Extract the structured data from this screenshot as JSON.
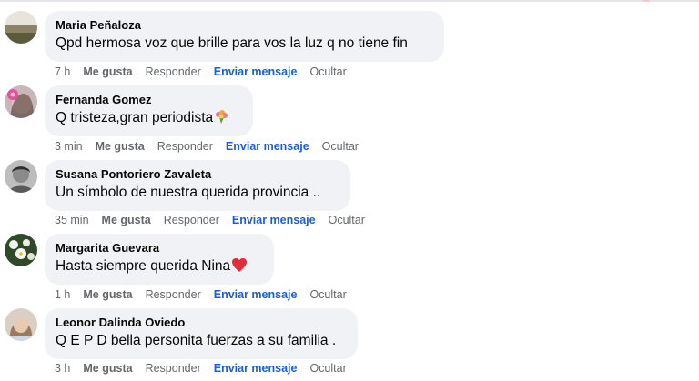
{
  "comments": [
    {
      "author": "Maria Peñaloza",
      "text": "Qpd hermosa voz que brille para vos la luz q no tiene fin",
      "time": "7 h",
      "like": "Me gusta",
      "reply": "Responder",
      "message": "Enviar mensaje",
      "hide": "Ocultar",
      "avatar": "landscape-photo"
    },
    {
      "author": "Fernanda Gomez",
      "text": "Q tristeza,gran periodista",
      "emoji": "bouquet-icon",
      "time": "3 min",
      "like": "Me gusta",
      "reply": "Responder",
      "message": "Enviar mensaje",
      "hide": "Ocultar",
      "avatar": "woman-with-pink-flower-photo"
    },
    {
      "author": "Susana Pontoriero Zavaleta",
      "text": "Un símbolo de nuestra querida provincia ..",
      "time": "35 min",
      "like": "Me gusta",
      "reply": "Responder",
      "message": "Enviar mensaje",
      "hide": "Ocultar",
      "avatar": "black-and-white-portrait"
    },
    {
      "author": "Margarita Guevara",
      "text": "Hasta siempre querida Nina",
      "emoji": "red-heart-icon",
      "time": "1 h",
      "like": "Me gusta",
      "reply": "Responder",
      "message": "Enviar mensaje",
      "hide": "Ocultar",
      "avatar": "white-flowers-photo"
    },
    {
      "author": "Leonor Dalinda Oviedo",
      "text": "Q E P D bella personita fuerzas a su familia .",
      "time": "3 h",
      "like": "Me gusta",
      "reply": "Responder",
      "message": "Enviar mensaje",
      "hide": "Ocultar",
      "avatar": "woman-portrait-photo"
    }
  ],
  "colors": {
    "bubble": "#f0f2f5",
    "text": "#050505",
    "meta": "#65676b",
    "link": "#1b5fd6"
  }
}
